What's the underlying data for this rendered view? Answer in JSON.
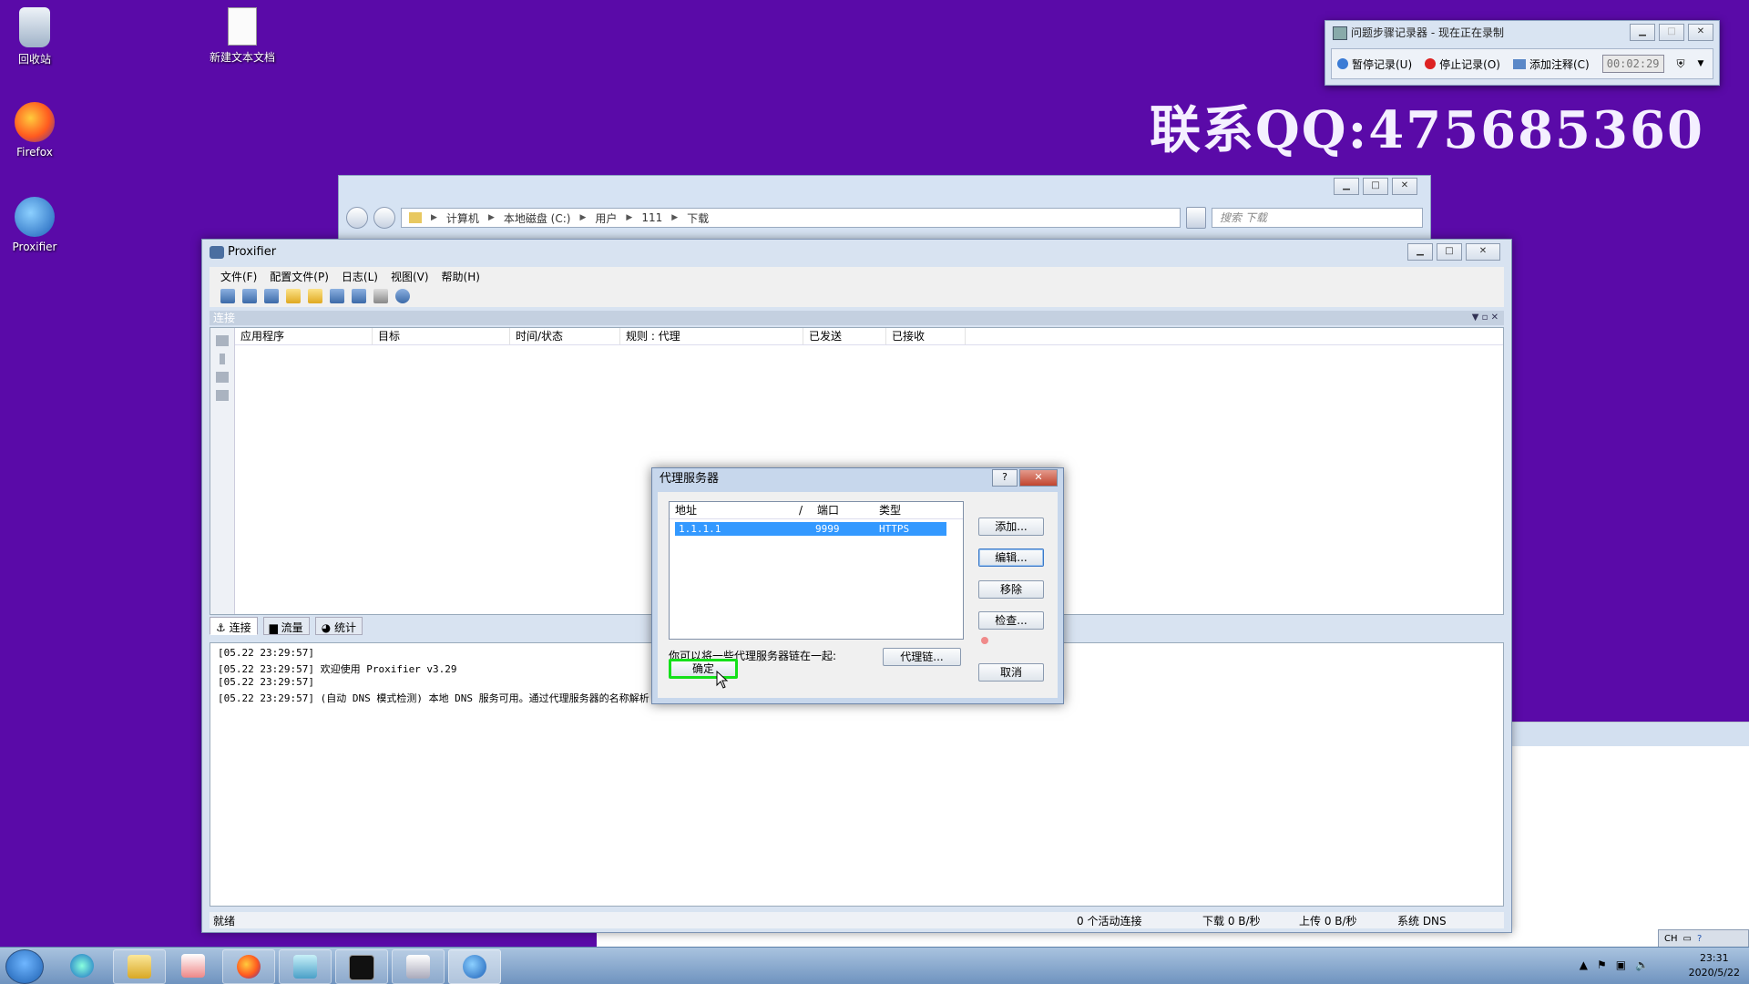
{
  "desktop": {
    "icons": [
      {
        "label": "回收站",
        "icon": "recycle-bin-icon"
      },
      {
        "label": "新建文本文档",
        "icon": "text-file-icon"
      },
      {
        "label": "Firefox",
        "icon": "firefox-icon"
      },
      {
        "label": "Proxifier",
        "icon": "proxifier-icon"
      }
    ],
    "watermark": "联系QQ:475685360"
  },
  "psr": {
    "title": "问题步骤记录器 - 现在正在录制",
    "pause": "暂停记录(U)",
    "stop": "停止记录(O)",
    "comment": "添加注释(C)",
    "timer": "00:02:29"
  },
  "explorer": {
    "breadcrumb": [
      "计算机",
      "本地磁盘 (C:)",
      "用户",
      "111",
      "下载"
    ],
    "search_placeholder": "搜索 下载"
  },
  "proxifier": {
    "title": "Proxifier",
    "menu": [
      "文件(F)",
      "配置文件(P)",
      "日志(L)",
      "视图(V)",
      "帮助(H)"
    ],
    "panel_title": "连接",
    "columns": [
      "应用程序",
      "目标",
      "时间/状态",
      "规则 : 代理",
      "已发送",
      "已接收"
    ],
    "tabs": [
      "连接",
      "流量",
      "统计"
    ],
    "log": [
      "[05.22 23:29:57]",
      "[05.22 23:29:57]     欢迎使用 Proxifier v3.29",
      "[05.22 23:29:57]",
      "[05.22 23:29:57] (自动 DNS 模式检测) 本地 DNS 服务可用。通过代理服务器的名称解析"
    ],
    "status": {
      "ready": "就绪",
      "active": "0 个活动连接",
      "download": "下载 0 B/秒",
      "upload": "上传 0 B/秒",
      "dns": "系统 DNS"
    }
  },
  "dialog": {
    "title": "代理服务器",
    "columns": [
      "地址",
      "/",
      "端口",
      "类型"
    ],
    "row": {
      "address": "1.1.1.1",
      "port": "9999",
      "type": "HTTPS"
    },
    "buttons": {
      "add": "添加...",
      "edit": "编辑...",
      "remove": "移除",
      "check": "检查...",
      "chain": "代理链...",
      "ok": "确定",
      "cancel": "取消"
    },
    "hint": "你可以将一些代理服务器链在一起:"
  },
  "taskbar": {
    "time": "23:31",
    "date": "2020/5/22",
    "lang": "CH"
  },
  "colors": {
    "desktop": "#5a0aa8",
    "selection": "#3399ff",
    "highlight": "#14e01a"
  }
}
